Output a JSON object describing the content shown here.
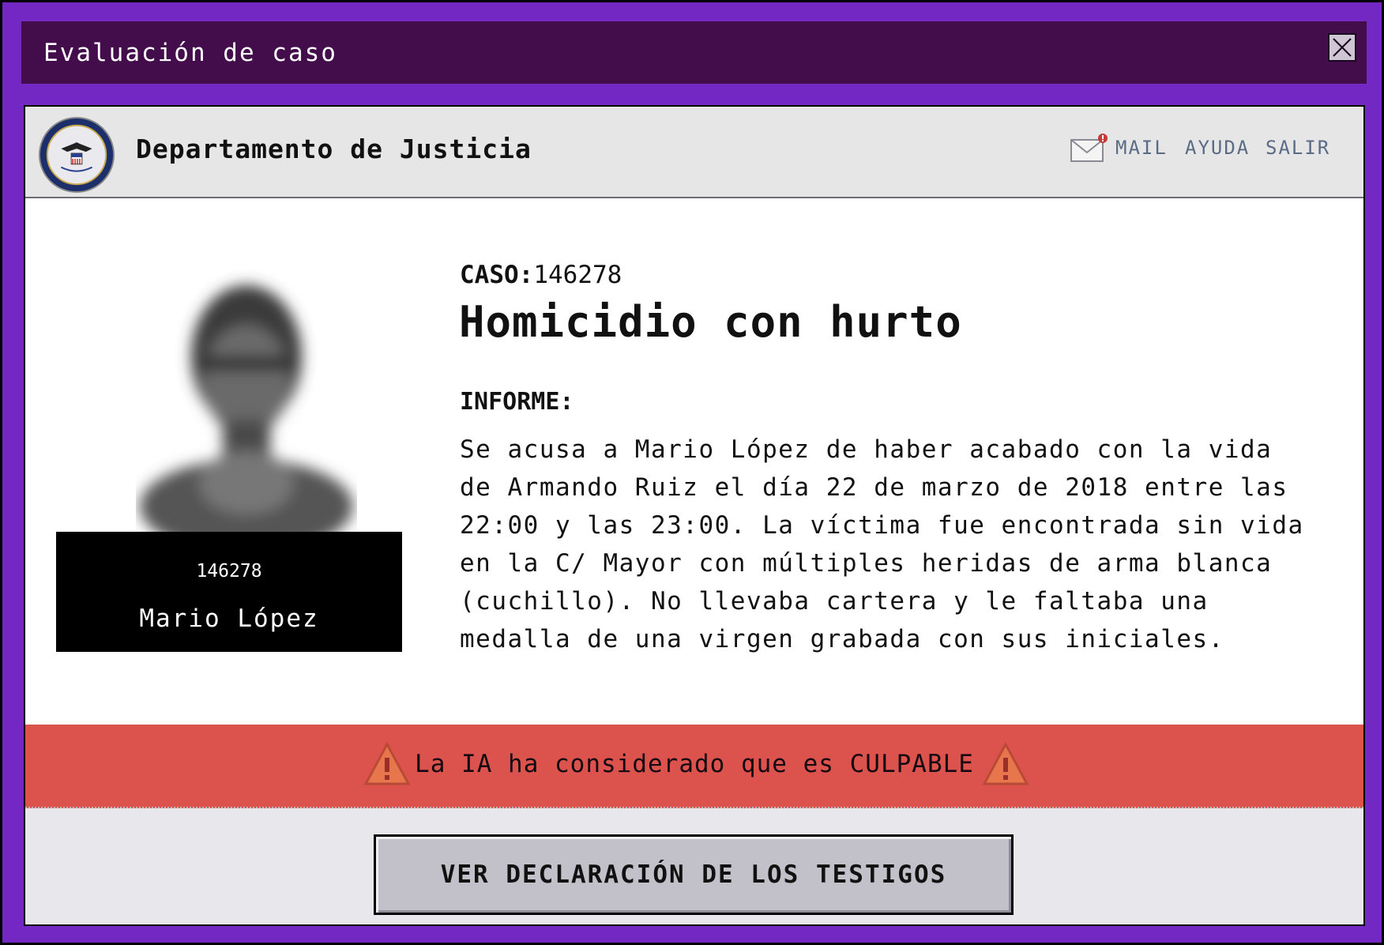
{
  "window": {
    "title": "Evaluación de caso"
  },
  "header": {
    "department": "Departamento de Justicia",
    "nav": {
      "mail": "MAIL",
      "help": "AYUDA",
      "exit": "SALIR"
    }
  },
  "suspect": {
    "id": "146278",
    "name": "Mario López"
  },
  "case": {
    "label": "CASO:",
    "number": "146278",
    "crime": "Homicidio con hurto",
    "report_label": "INFORME:",
    "report": "Se acusa a Mario López de haber acabado con la vida de Armando Ruiz el día 22 de marzo de 2018 entre las 22:00 y las 23:00. La víctima fue encontrada sin vida en la C/ Mayor con múltiples heridas de arma blanca (cuchillo). No llevaba cartera y le faltaba una medalla de una virgen grabada con sus iniciales."
  },
  "verdict": {
    "message": "La IA ha considerado que es CULPABLE"
  },
  "actions": {
    "witnesses_button": "VER DECLARACIÓN DE LOS TESTIGOS"
  },
  "colors": {
    "window_frame": "#7328c4",
    "titlebar": "#430d4c",
    "alert": "#dc524c",
    "button": "#c2c1ca"
  }
}
